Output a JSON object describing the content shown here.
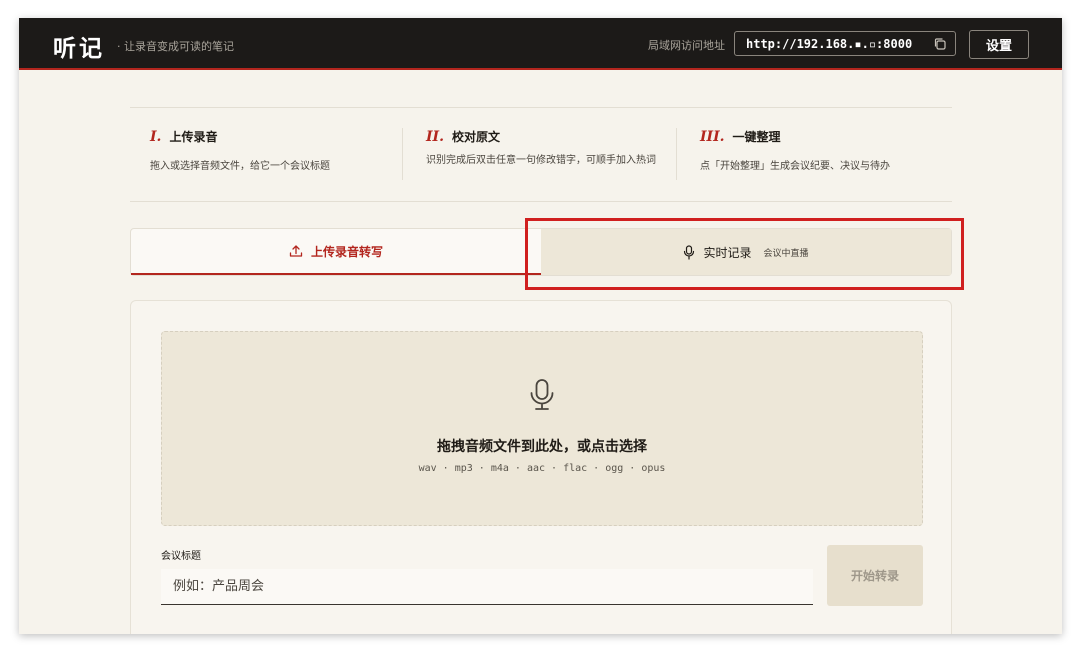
{
  "header": {
    "brand": "听记",
    "tagline": "· 让录音变成可读的笔记",
    "lan_label": "局域网访问地址",
    "lan_address": "http://192.168.▪.▫:8000",
    "settings_label": "设置"
  },
  "steps": [
    {
      "num": "I.",
      "title": "上传录音",
      "desc": "拖入或选择音频文件，给它一个会议标题"
    },
    {
      "num": "II.",
      "title": "校对原文",
      "desc": "识别完成后双击任意一句修改错字，可顺手加入热词"
    },
    {
      "num": "III.",
      "title": "一键整理",
      "desc": "点「开始整理」生成会议纪要、决议与待办"
    }
  ],
  "tabs": {
    "upload_label": "上传录音转写",
    "live_label": "实时记录",
    "live_sub": "会议中直播"
  },
  "upload": {
    "dropzone_title": "拖拽音频文件到此处，或点击选择",
    "formats": "wav · mp3 · m4a · aac · flac · ogg · opus",
    "title_label": "会议标题",
    "title_placeholder": "例如：产品周会",
    "title_value": "",
    "start_label": "开始转录"
  },
  "colors": {
    "accent": "#b3261e",
    "header_bg": "#1c1a18",
    "page_bg": "#f6f3ec",
    "highlight": "#d01f1f"
  },
  "icons": {
    "copy": "copy-icon",
    "upload": "upload-icon",
    "mic": "microphone-icon"
  }
}
